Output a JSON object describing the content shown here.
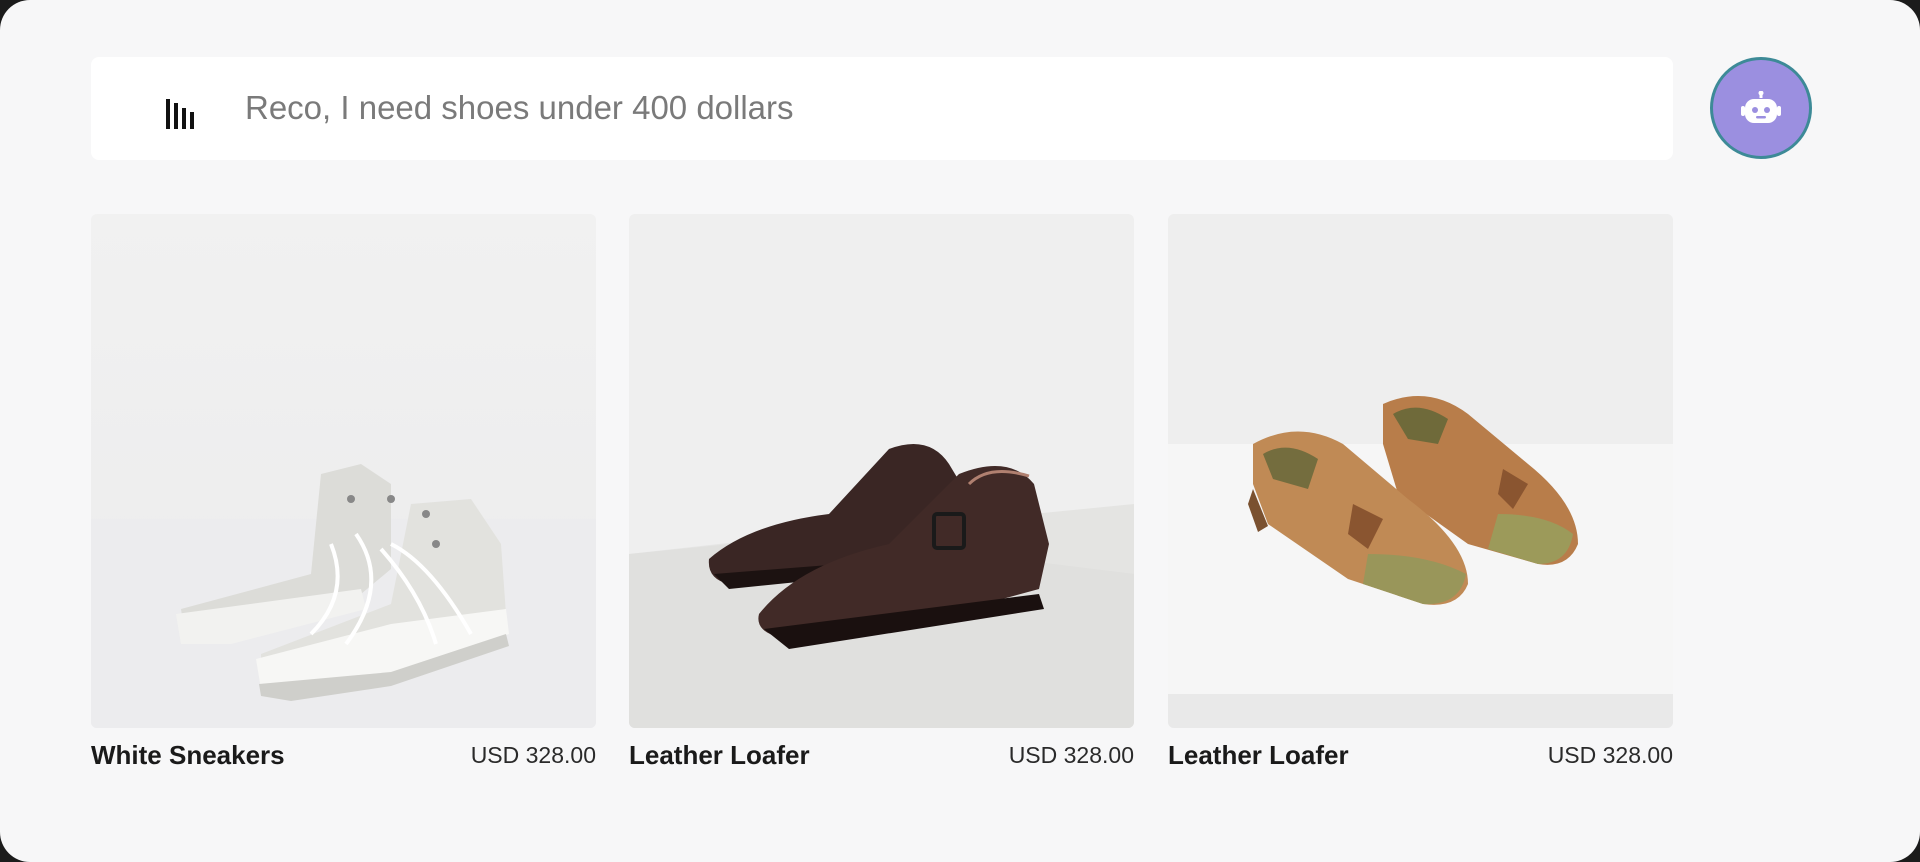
{
  "search": {
    "placeholder": "Reco, I need shoes under 400 dollars",
    "value": ""
  },
  "assistant": {
    "icon": "robot-icon",
    "accent": "#9b8fe0",
    "ring": "#3d8a97"
  },
  "products": [
    {
      "title": "White Sneakers",
      "price": "USD 328.00",
      "image": "white-high-top-sneakers"
    },
    {
      "title": "Leather Loafer",
      "price": "USD 328.00",
      "image": "black-leather-brogue-loafers"
    },
    {
      "title": "Leather Loafer",
      "price": "USD 328.00",
      "image": "tan-leather-tassel-loafers"
    }
  ]
}
